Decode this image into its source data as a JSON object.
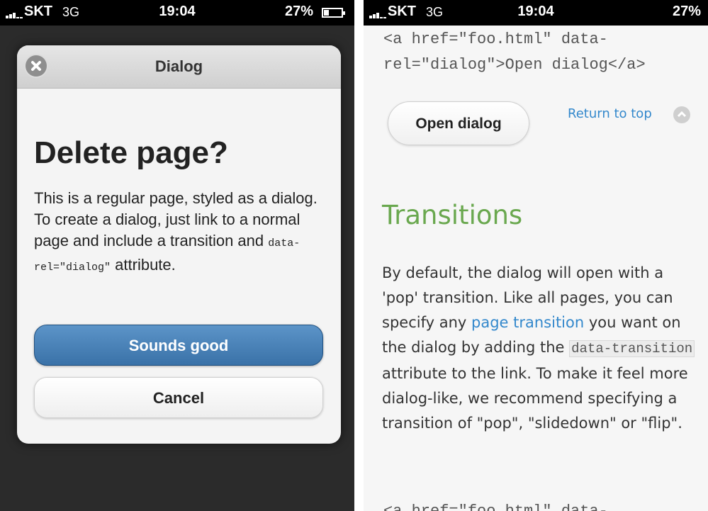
{
  "left": {
    "statusbar": {
      "carrier": "SKT",
      "network": "3G",
      "time": "19:04",
      "battery": "27%",
      "battery_level": 0.27
    },
    "dialog": {
      "title": "Dialog",
      "heading": "Delete page?",
      "body_text": "This is a regular page, styled as a dialog. To create a dialog, just link to a normal page and include a transition and",
      "body_code": "data-rel=\"dialog\"",
      "body_end": "attribute.",
      "primary_button": "Sounds good",
      "secondary_button": "Cancel"
    }
  },
  "right": {
    "statusbar": {
      "carrier": "SKT",
      "network": "3G",
      "time": "19:04",
      "battery": "27%",
      "battery_level": 0.27
    },
    "code_top": "<a href=\"foo.html\" data-\nrel=\"dialog\">Open dialog</a>",
    "open_dialog_button": "Open dialog",
    "return_to_top": "Return to top",
    "section_heading": "Transitions",
    "paragraph": {
      "p1": "By default, the dialog will open with a 'pop' transition. Like all pages, you can specify any",
      "link": "page transition",
      "p2": "you want on the dialog by adding the",
      "code": "data-transition",
      "p3": "attribute to the link. To make it feel more dialog-like, we recommend specifying a transition of \"pop\", \"slidedown\" or \"flip\"."
    },
    "code_bottom": "<a href=\"foo.html\" data-"
  }
}
